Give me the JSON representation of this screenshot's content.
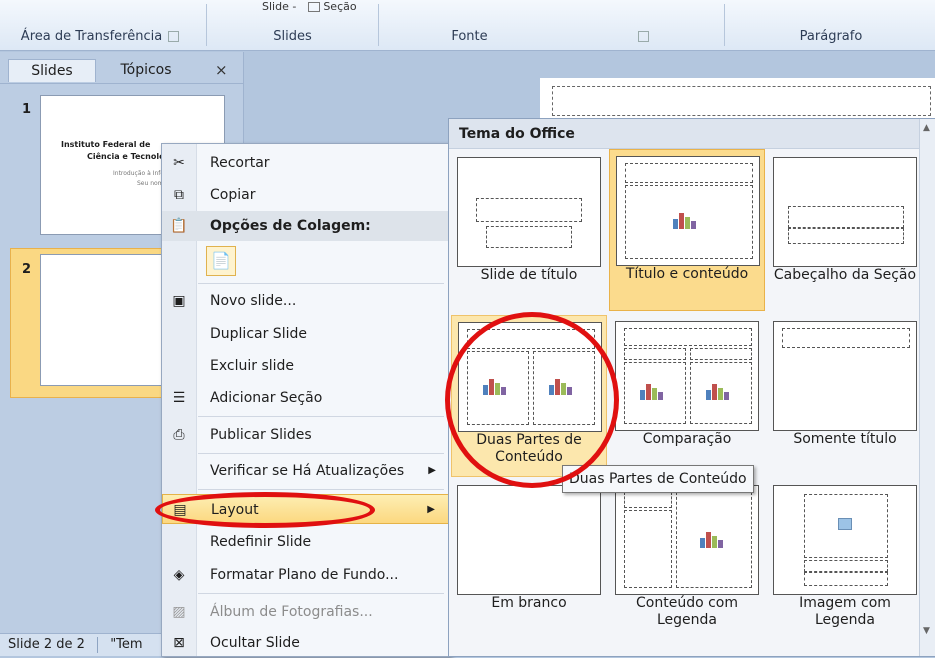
{
  "ribbon": {
    "top_fragment": "Slide -",
    "top_fragment2": "Seção",
    "groups": [
      "Área de Transferência",
      "Slides",
      "Fonte",
      "Parágrafo"
    ]
  },
  "left_pane": {
    "tabs": [
      "Slides",
      "Tópicos"
    ],
    "close": "×",
    "slide1": {
      "num": "1",
      "title1": "Instituto Federal de",
      "title2": "Ciência e Tecnolog",
      "subtitle": "Introdução à Inform",
      "author": "Seu nome"
    },
    "slide2": {
      "num": "2"
    }
  },
  "status": {
    "slide_count": "Slide 2 de 2",
    "theme": "\"Tem"
  },
  "context_menu": {
    "items": [
      {
        "label": "Recortar",
        "icon": "scissors-icon"
      },
      {
        "label": "Copiar",
        "icon": "copy-icon"
      },
      {
        "label": "Opções de Colagem:",
        "icon": "paste-icon"
      },
      {
        "label": "",
        "icon": "paste-option-icon"
      },
      {
        "label": "Novo slide...",
        "icon": "new-slide-icon"
      },
      {
        "label": "Duplicar Slide",
        "icon": ""
      },
      {
        "label": "Excluir slide",
        "icon": ""
      },
      {
        "label": "Adicionar Seção",
        "icon": "add-section-icon"
      },
      {
        "label": "Publicar Slides",
        "icon": "publish-slides-icon"
      },
      {
        "label": "Verificar se Há Atualizações",
        "icon": ""
      },
      {
        "label": "Layout",
        "icon": "layout-icon"
      },
      {
        "label": "Redefinir Slide",
        "icon": ""
      },
      {
        "label": "Formatar Plano de Fundo...",
        "icon": "format-background-icon"
      },
      {
        "label": "Álbum de Fotografias...",
        "icon": "photo-album-icon"
      },
      {
        "label": "Ocultar Slide",
        "icon": "hide-slide-icon"
      }
    ]
  },
  "layout_gallery": {
    "title": "Tema do Office",
    "layouts": [
      "Slide de título",
      "Título e conteúdo",
      "Cabeçalho da Seção",
      "Duas Partes de Conteúdo",
      "Comparação",
      "Somente título",
      "Em branco",
      "Conteúdo com Legenda",
      "Imagem com Legenda"
    ],
    "selected": "Título e conteúdo",
    "hovered": "Duas Partes de Conteúdo"
  },
  "tooltip": "Duas Partes de Conteúdo",
  "colors": {
    "annotation": "#e01010",
    "highlight": "#fcd880"
  }
}
